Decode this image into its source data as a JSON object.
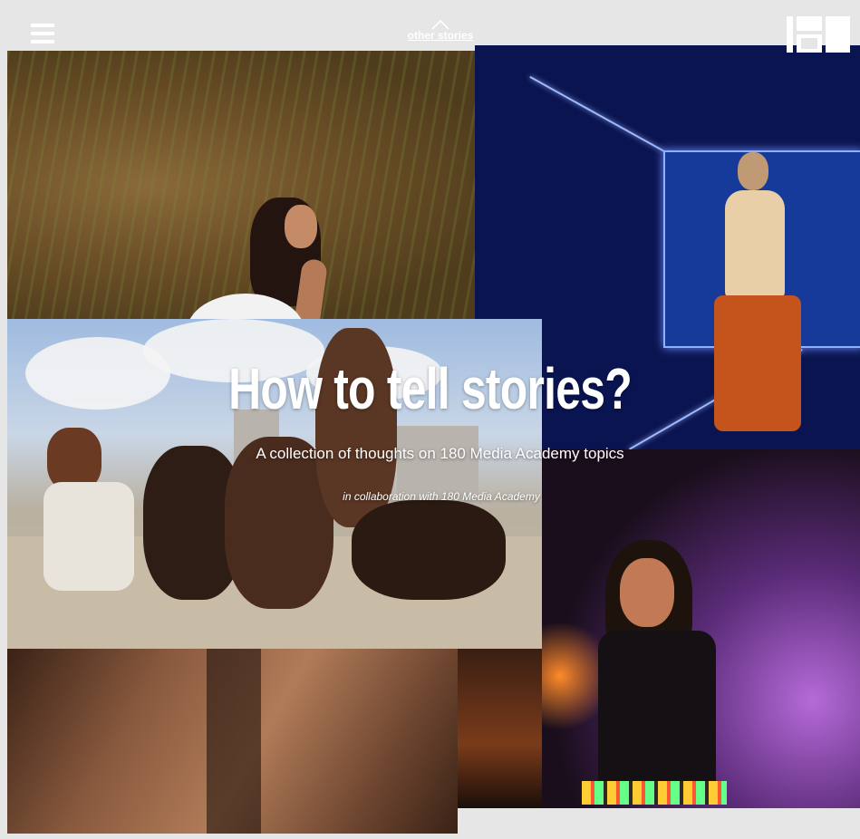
{
  "header": {
    "menu_icon": "hamburger-menu-icon",
    "nav_link": "other stories",
    "nav_icon": "chevron-up-icon",
    "logo": "180-logo"
  },
  "hero": {
    "title": "How to tell stories?",
    "subtitle": "A collection of thoughts on 180 Media Academy topics",
    "collaboration": "in collaboration with 180 Media Academy"
  },
  "colors": {
    "background": "#e6e6e6",
    "text": "#ffffff"
  }
}
